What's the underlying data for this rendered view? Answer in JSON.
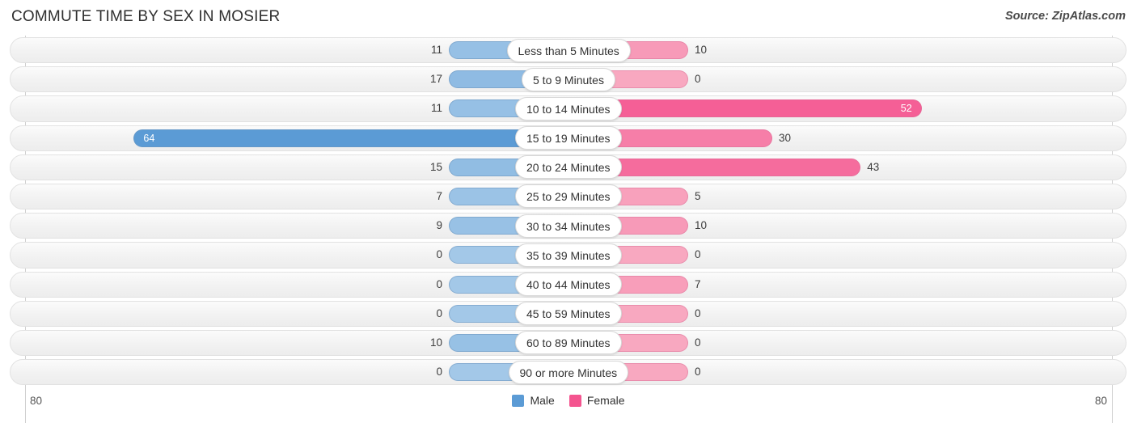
{
  "header": {
    "title": "COMMUTE TIME BY SEX IN MOSIER",
    "source": "Source: ZipAtlas.com"
  },
  "axis": {
    "left_label": "80",
    "right_label": "80",
    "max": 80
  },
  "legend": {
    "items": [
      {
        "label": "Male",
        "color": "#5b9bd5"
      },
      {
        "label": "Female",
        "color": "#f4548f"
      }
    ]
  },
  "colors": {
    "male_light": "#a3c8e8",
    "male_dark": "#5b9bd5",
    "female_light": "#f8a8c0",
    "female_dark": "#f4548f",
    "track": "#f2f2f2",
    "gridline": "#cfcfcf"
  },
  "chart_data": {
    "type": "bar",
    "title": "COMMUTE TIME BY SEX IN MOSIER",
    "orientation": "horizontal-diverging",
    "xlabel": "",
    "ylabel": "",
    "xlim": [
      80,
      80
    ],
    "grid": true,
    "legend_position": "bottom-center",
    "categories": [
      "Less than 5 Minutes",
      "5 to 9 Minutes",
      "10 to 14 Minutes",
      "15 to 19 Minutes",
      "20 to 24 Minutes",
      "25 to 29 Minutes",
      "30 to 34 Minutes",
      "35 to 39 Minutes",
      "40 to 44 Minutes",
      "45 to 59 Minutes",
      "60 to 89 Minutes",
      "90 or more Minutes"
    ],
    "series": [
      {
        "name": "Male",
        "values": [
          11,
          17,
          11,
          64,
          15,
          7,
          9,
          0,
          0,
          0,
          10,
          0
        ]
      },
      {
        "name": "Female",
        "values": [
          10,
          0,
          52,
          30,
          43,
          5,
          10,
          0,
          7,
          0,
          0,
          0
        ]
      }
    ]
  },
  "rows": [
    {
      "label": "Less than 5 Minutes",
      "male": "11",
      "female": "10"
    },
    {
      "label": "5 to 9 Minutes",
      "male": "17",
      "female": "0"
    },
    {
      "label": "10 to 14 Minutes",
      "male": "11",
      "female": "52"
    },
    {
      "label": "15 to 19 Minutes",
      "male": "64",
      "female": "30"
    },
    {
      "label": "20 to 24 Minutes",
      "male": "15",
      "female": "43"
    },
    {
      "label": "25 to 29 Minutes",
      "male": "7",
      "female": "5"
    },
    {
      "label": "30 to 34 Minutes",
      "male": "9",
      "female": "10"
    },
    {
      "label": "35 to 39 Minutes",
      "male": "0",
      "female": "0"
    },
    {
      "label": "40 to 44 Minutes",
      "male": "0",
      "female": "7"
    },
    {
      "label": "45 to 59 Minutes",
      "male": "0",
      "female": "0"
    },
    {
      "label": "60 to 89 Minutes",
      "male": "10",
      "female": "0"
    },
    {
      "label": "90 or more Minutes",
      "male": "0",
      "female": "0"
    }
  ]
}
